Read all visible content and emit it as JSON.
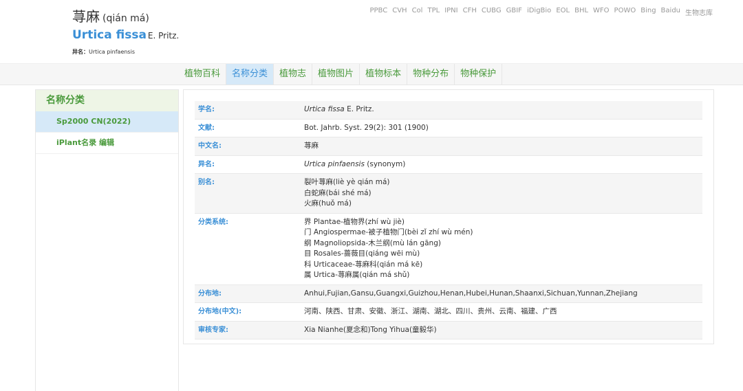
{
  "header": {
    "title_cn": "荨麻",
    "title_pinyin": "(qián má)",
    "sci_name": "Urtica fissa",
    "sci_author": "E. Pritz.",
    "synonym_label": "异名：",
    "synonym_value": "Urtica pinfaensis"
  },
  "links": [
    "PPBC",
    "CVH",
    "Col",
    "TPL",
    "IPNI",
    "CFH",
    "CUBG",
    "GBIF",
    "iDigBio",
    "EOL",
    "BHL",
    "WFO",
    "POWO",
    "Bing",
    "Baidu",
    "生物志库"
  ],
  "tabs": [
    "植物百科",
    "名称分类",
    "植物志",
    "植物图片",
    "植物标本",
    "物种分布",
    "物种保护"
  ],
  "active_tab": 1,
  "sidebar": {
    "heading": "名称分类",
    "items": [
      "Sp2000 CN(2022)",
      "iPlant名录 编辑"
    ]
  },
  "details": {
    "sci_label": "学名:",
    "sci_name": "Urtica fissa",
    "sci_author": " E. Pritz.",
    "ref_label": "文献:",
    "ref_value": "Bot. Jahrb. Syst. 29(2): 301 (1900)",
    "cn_label": "中文名:",
    "cn_value": "荨麻",
    "syn_label": "异名:",
    "syn_name": "Urtica pinfaensis",
    "syn_note": " (synonym)",
    "alias_label": "别名:",
    "alias_values": [
      "裂叶荨麻(liè yè qián má)",
      "白蛇麻(bái shé má)",
      "火麻(huǒ má)"
    ],
    "class_label": "分类系统:",
    "class_values": [
      "界 Plantae-植物界(zhí wù jiè)",
      "门 Angiospermae-被子植物门(bèi zǐ zhí wù mén)",
      "纲 Magnoliopsida-木兰纲(mù lán gāng)",
      "目 Rosales-蔷薇目(qiáng wēi mù)",
      "科 Urticaceae-荨麻科(qián má kē)",
      "属 Urtica-荨麻属(qián má shǔ)"
    ],
    "dist_label": "分布地:",
    "dist_value": "Anhui,Fujian,Gansu,Guangxi,Guizhou,Henan,Hubei,Hunan,Shaanxi,Sichuan,Yunnan,Zhejiang",
    "dist_cn_label": "分布地(中文):",
    "dist_cn_value": "河南、陕西、甘肃、安徽、浙江、湖南、湖北、四川、贵州、云南、福建、广西",
    "expert_label": "审核专家:",
    "expert_value": "Xia Nianhe(夏念和)Tong Yihua(童毅华)"
  },
  "colors": {
    "accent_blue": "#3a8fd6",
    "accent_green": "#4a9a3c",
    "active_bg": "#d6e9f8"
  }
}
